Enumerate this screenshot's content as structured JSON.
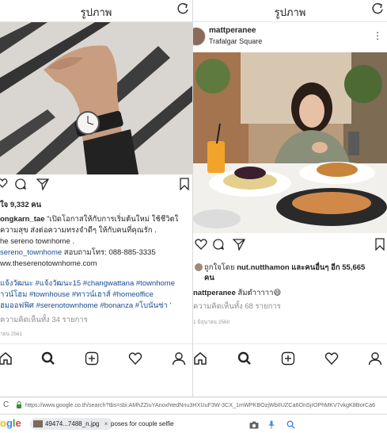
{
  "left_panel": {
    "header_title": "รูปภาพ",
    "likes": "ใจ 9,332 คน",
    "caption_lines": [
      {
        "user": "ongkarn_tae",
        "text": " \"เปิดโอกาสให้กับการเริ่มต้นใหม่  ใช้ชีวิตใ"
      },
      {
        "user": "",
        "text": "ความสุข ส่งต่อความทรงจำดีๆ ให้กับคนที่คุณรัก ."
      },
      {
        "user": "",
        "text": "he sereno townhome ."
      },
      {
        "user": "",
        "text": "sereno_townhome สอบถามโทร: 088-885-3335",
        "link_part": "sereno_townhome"
      },
      {
        "user": "",
        "text": "ww.theserenotownhome.com"
      }
    ],
    "hashtags": [
      "แจ้งวัฒนะ #แจ้งวัฒนะ15 #changwattana #townhome",
      "าวน์โฮม #townhouse #ทาวน์เฮาส์ #homeoffice",
      "ฮมออฟฟิศ #serenotownhome #bonanza #โบนันซ่า '"
    ],
    "comments": "ความคิดเห็นทั้ง 34 รายการ",
    "date": "ายน 2561"
  },
  "right_panel": {
    "header_title": "รูปภาพ",
    "username": "mattperanee",
    "location": "Trafalgar Square",
    "liked_by_prefix": "ถูกใจโดย ",
    "liked_by_user": "nut.nutthamon",
    "liked_by_suffix": " และคนอื่นๆ อีก 55,665",
    "liked_by_line2": "คน",
    "caption_user": "nattperanee",
    "caption_text": " ส้มตำาาาา😄",
    "comments": "ความคิดเห็นทั้ง 68 รายการ",
    "date": "1 มิถุนายน 2560"
  },
  "browser": {
    "url": "https://www.google.co.th/search?tbs=sbi:AMhZZiuYAnoxhtedNnu3HXUuF3W-3CX_1mWPKBOzjWbIIUZCa6OnSjrOPhMKV7vkgK8BorCa6",
    "google_logo": "ogle",
    "image_chip": "49474...7488_n.jpg",
    "query": "poses for couple selfie",
    "chip_close": "×"
  },
  "colors": {
    "link": "#1a4d8f",
    "muted": "#8e8e8e",
    "google_blue": "#4285f4",
    "google_red": "#ea4335",
    "google_yellow": "#fbbc05",
    "google_green": "#34a853"
  }
}
